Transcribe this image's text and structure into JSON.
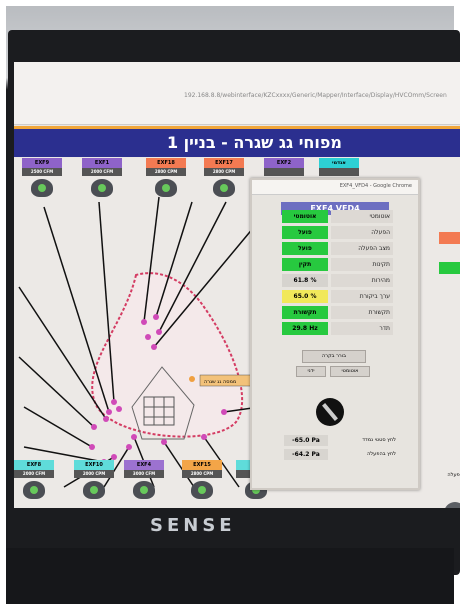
{
  "browser": {
    "url": "192.168.8.8/webinterface/KZCxxxx/Generic/Mapper/Interface/Display/HVCOmm/Screen"
  },
  "page": {
    "title": "מפוחי גג שגרה - בניין 1"
  },
  "fans_top": [
    {
      "label": "EXF9",
      "cpm": "2500 CFM",
      "color": "#8e63c9"
    },
    {
      "label": "EXF1",
      "cpm": "2000 CFM",
      "color": "#8e63c9"
    },
    {
      "label": "EXF18",
      "cpm": "2800 CPM",
      "color": "#f37a52"
    },
    {
      "label": "EXF17",
      "cpm": "2800 CPM",
      "color": "#f37a52"
    },
    {
      "label": "EXF2",
      "cpm": "",
      "color": "#8e63c9"
    },
    {
      "label": "אגדמי",
      "cpm": "",
      "color": "#2dd0d4"
    }
  ],
  "fans_bottom": [
    {
      "label": "EXF8",
      "cpm": "2000 CFM",
      "color": "#5fdcda"
    },
    {
      "label": "EXF10",
      "cpm": "2000 CPM",
      "color": "#5fdcda"
    },
    {
      "label": "EXF4",
      "cpm": "3000 CFM",
      "color": "#9c72d0"
    },
    {
      "label": "EXF15",
      "cpm": "2800 CPM",
      "color": "#f3a548"
    },
    {
      "label": "EXF",
      "cpm": "",
      "color": "#5fdcda"
    }
  ],
  "floorplan": {
    "tag": "ממסה גג שגרה"
  },
  "popup": {
    "window_title": "EXF4_VFD4 - Google Chrome",
    "header": "EXF4 VFD4",
    "rows": [
      {
        "key": "אוטומטי",
        "value": "אוטומטי",
        "color": "#27c93f"
      },
      {
        "key": "הפעלה",
        "value": "פועל",
        "color": "#27c93f"
      },
      {
        "key": "מצב הפעלה",
        "value": "פועל",
        "color": "#27c93f"
      },
      {
        "key": "תקינות",
        "value": "תקין",
        "color": "#27c93f"
      },
      {
        "key": "מהירות",
        "value": "61.8 %",
        "color": "#d6d3ce"
      },
      {
        "key": "ערך ביקורת",
        "value": "65.0 %",
        "color": "#f1e85a"
      },
      {
        "key": "תקשורת",
        "value": "תקשורת",
        "color": "#27c93f"
      },
      {
        "key": "תדר",
        "value": "29.8 Hz",
        "color": "#27c93f"
      }
    ],
    "buttons": {
      "mode": "בורר בקרה",
      "b1": "ידני",
      "b2": "אוטומטי"
    },
    "pressure": [
      {
        "key": "לחץ סטטי נמדד",
        "value": "-65.0 Pa"
      },
      {
        "key": "לחץ בהפעלה",
        "value": "-64.2 Pa"
      }
    ]
  },
  "monitor": {
    "brand": "SENSE"
  },
  "right_panel": {
    "label": "מצבי הפעלה"
  }
}
